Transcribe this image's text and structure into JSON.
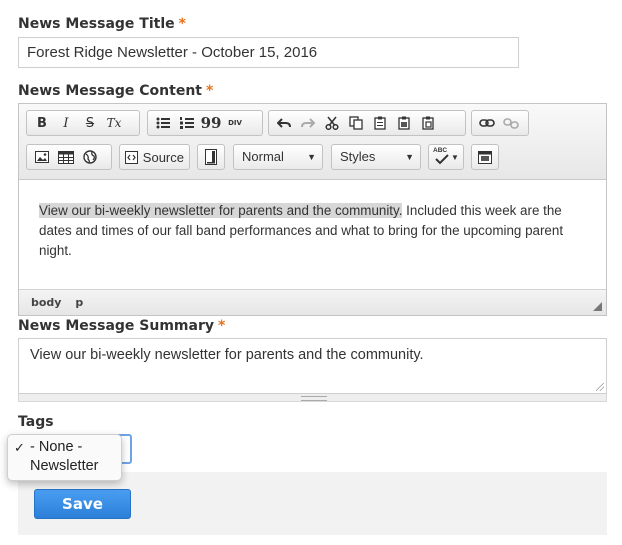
{
  "form": {
    "title_label": "News Message Title",
    "title_value": "Forest Ridge Newsletter - October 15, 2016",
    "content_label": "News Message Content",
    "summary_label": "News Message Summary",
    "tags_label": "Tags",
    "required_mark": "*",
    "accent_color": "#e8711a"
  },
  "toolbar": {
    "bold": "B",
    "italic": "I",
    "strike": "S",
    "clear_format": "Tx",
    "blockquote": "99",
    "div": "DIV",
    "source_label": "Source",
    "format_value": "Normal",
    "styles_value": "Styles",
    "spellcheck": "ABC"
  },
  "editor": {
    "highlighted_text": "View our bi-weekly newsletter for parents and the community.",
    "rest_text": " Included this week are the dates and times of our fall band performances and what to bring for the upcoming parent night.",
    "path": [
      "body",
      "p"
    ]
  },
  "summary": {
    "value": "View our bi-weekly newsletter for parents and the community."
  },
  "tags_dropdown": {
    "options": [
      {
        "label": "- None -",
        "selected": true
      },
      {
        "label": "Newsletter",
        "selected": false
      }
    ],
    "check_mark": "✓"
  },
  "actions": {
    "save_label": "Save",
    "save_color": "#2b7fd8"
  }
}
